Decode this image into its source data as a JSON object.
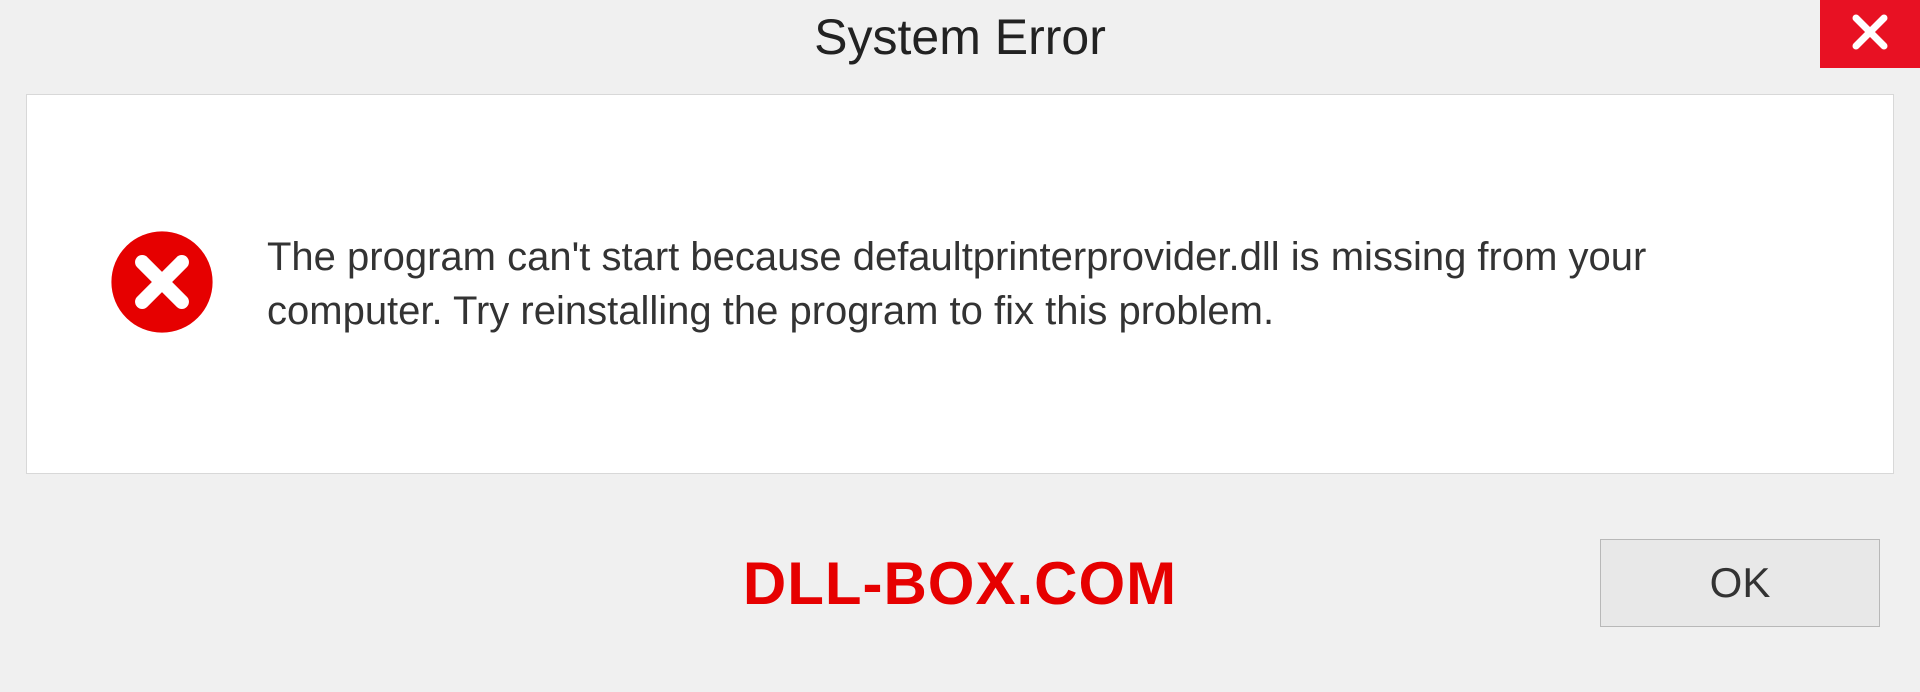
{
  "dialog": {
    "title": "System Error",
    "message": "The program can't start because defaultprinterprovider.dll is missing from your computer. Try reinstalling the program to fix this problem.",
    "ok_label": "OK"
  },
  "watermark": "DLL-BOX.COM",
  "colors": {
    "close_bg": "#e81123",
    "error_red": "#e60000",
    "panel_bg": "#ffffff",
    "dialog_bg": "#f0f0f0"
  }
}
